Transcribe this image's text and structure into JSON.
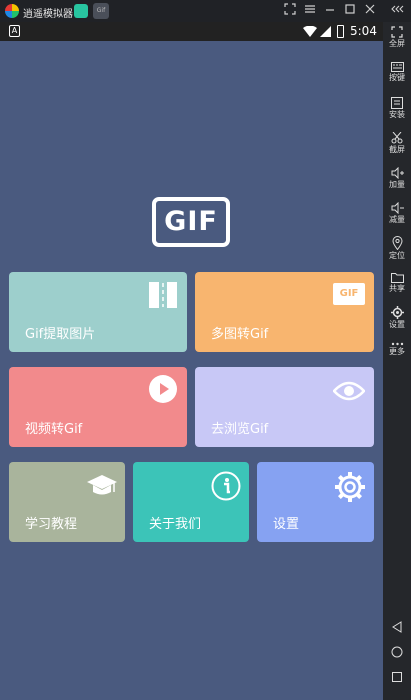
{
  "window": {
    "title": "逍遥模拟器",
    "tab2_label": "Gif",
    "controls": [
      "fullscreen-exit-icon",
      "menu-icon",
      "minimize-icon",
      "maximize-icon",
      "close-icon",
      "collapse-icon"
    ]
  },
  "statusbar": {
    "notification_letter": "A",
    "time": "5:04"
  },
  "app": {
    "logo_text": "GIF",
    "tiles": [
      {
        "label": "Gif提取图片",
        "icon": "film-strip-icon"
      },
      {
        "label": "多图转Gif",
        "icon": "gif-badge-icon",
        "badge": "GIF"
      },
      {
        "label": "视频转Gif",
        "icon": "play-icon"
      },
      {
        "label": "去浏览Gif",
        "icon": "eye-icon"
      },
      {
        "label": "学习教程",
        "icon": "graduation-cap-icon"
      },
      {
        "label": "关于我们",
        "icon": "info-icon"
      },
      {
        "label": "设置",
        "icon": "gear-icon"
      }
    ]
  },
  "sidebar": {
    "items": [
      {
        "label": "全屏",
        "icon": "fullscreen-icon"
      },
      {
        "label": "按键",
        "icon": "keyboard-icon"
      },
      {
        "label": "安装",
        "icon": "apk-install-icon"
      },
      {
        "label": "截屏",
        "icon": "scissors-icon"
      },
      {
        "label": "加量",
        "icon": "volume-up-icon"
      },
      {
        "label": "减量",
        "icon": "volume-down-icon"
      },
      {
        "label": "定位",
        "icon": "location-pin-icon"
      },
      {
        "label": "共享",
        "icon": "folder-icon"
      },
      {
        "label": "设置",
        "icon": "gear-icon"
      },
      {
        "label": "更多",
        "icon": "more-icon"
      }
    ],
    "nav": [
      "back-icon",
      "home-icon",
      "recents-icon"
    ]
  }
}
